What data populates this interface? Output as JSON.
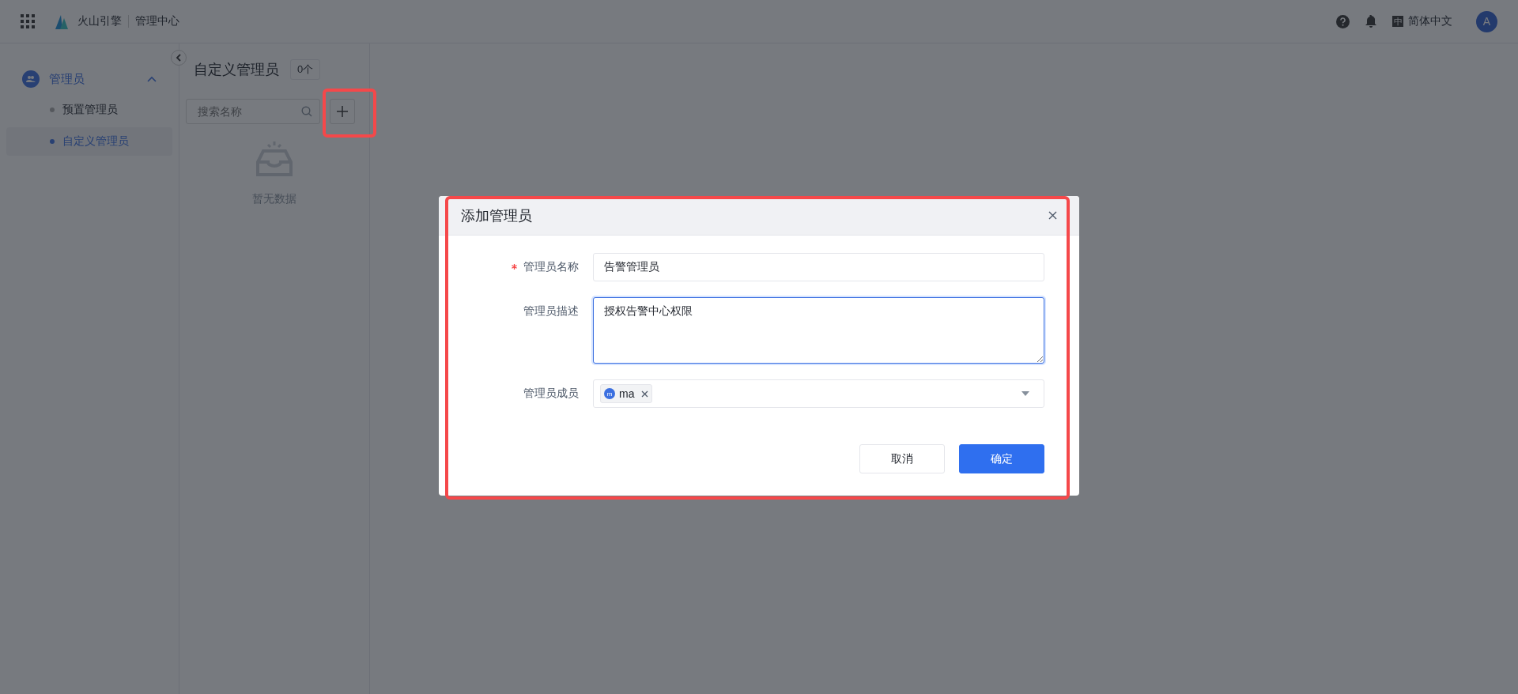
{
  "topbar": {
    "brand": "火山引擎",
    "product": "管理中心",
    "language_badge": "中",
    "language": "简体中文",
    "avatar": "A"
  },
  "sidebar": {
    "group": {
      "label": "管理员",
      "expanded": true,
      "items": [
        {
          "label": "预置管理员",
          "selected": false
        },
        {
          "label": "自定义管理员",
          "selected": true
        }
      ]
    }
  },
  "panel": {
    "title": "自定义管理员",
    "count": "0个",
    "search": {
      "placeholder": "搜索名称"
    },
    "empty": "暂无数据"
  },
  "dialog": {
    "title": "添加管理员",
    "fields": [
      {
        "kind": "input",
        "label": "管理员名称",
        "required": true,
        "value": "告警管理员"
      },
      {
        "kind": "textarea",
        "label": "管理员描述",
        "required": false,
        "value": "授权告警中心权限",
        "focused": true
      },
      {
        "kind": "select",
        "label": "管理员成员",
        "required": false,
        "tags": [
          {
            "initial": "m",
            "label": "ma"
          }
        ]
      }
    ],
    "buttons": [
      {
        "label": "取消",
        "kind": "default"
      },
      {
        "label": "确定",
        "kind": "primary"
      }
    ]
  }
}
